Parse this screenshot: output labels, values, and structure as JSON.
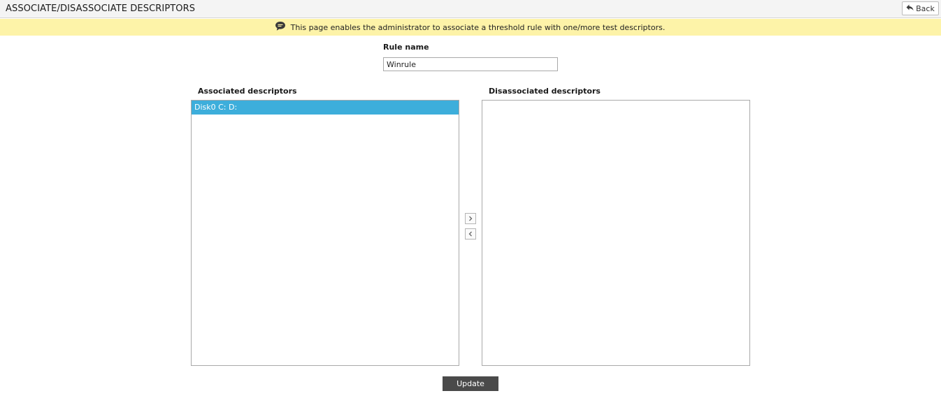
{
  "header": {
    "title": "ASSOCIATE/DISASSOCIATE DESCRIPTORS",
    "back_label": "Back"
  },
  "info": {
    "icon": "speech-bubble-icon",
    "text": "This page enables the administrator to associate a threshold rule with one/more test descriptors."
  },
  "rule": {
    "label": "Rule name",
    "value": "Winrule"
  },
  "associated": {
    "label": "Associated descriptors",
    "items": [
      {
        "label": "Disk0 C: D:",
        "selected": true
      }
    ]
  },
  "disassociated": {
    "label": "Disassociated descriptors",
    "items": []
  },
  "controls": {
    "move_right_icon": "chevron-right-icon",
    "move_left_icon": "chevron-left-icon",
    "update_label": "Update"
  },
  "colors": {
    "info_bar": "#fdf3a8",
    "selected_item": "#3daedb",
    "update_button": "#4a4a4a"
  }
}
